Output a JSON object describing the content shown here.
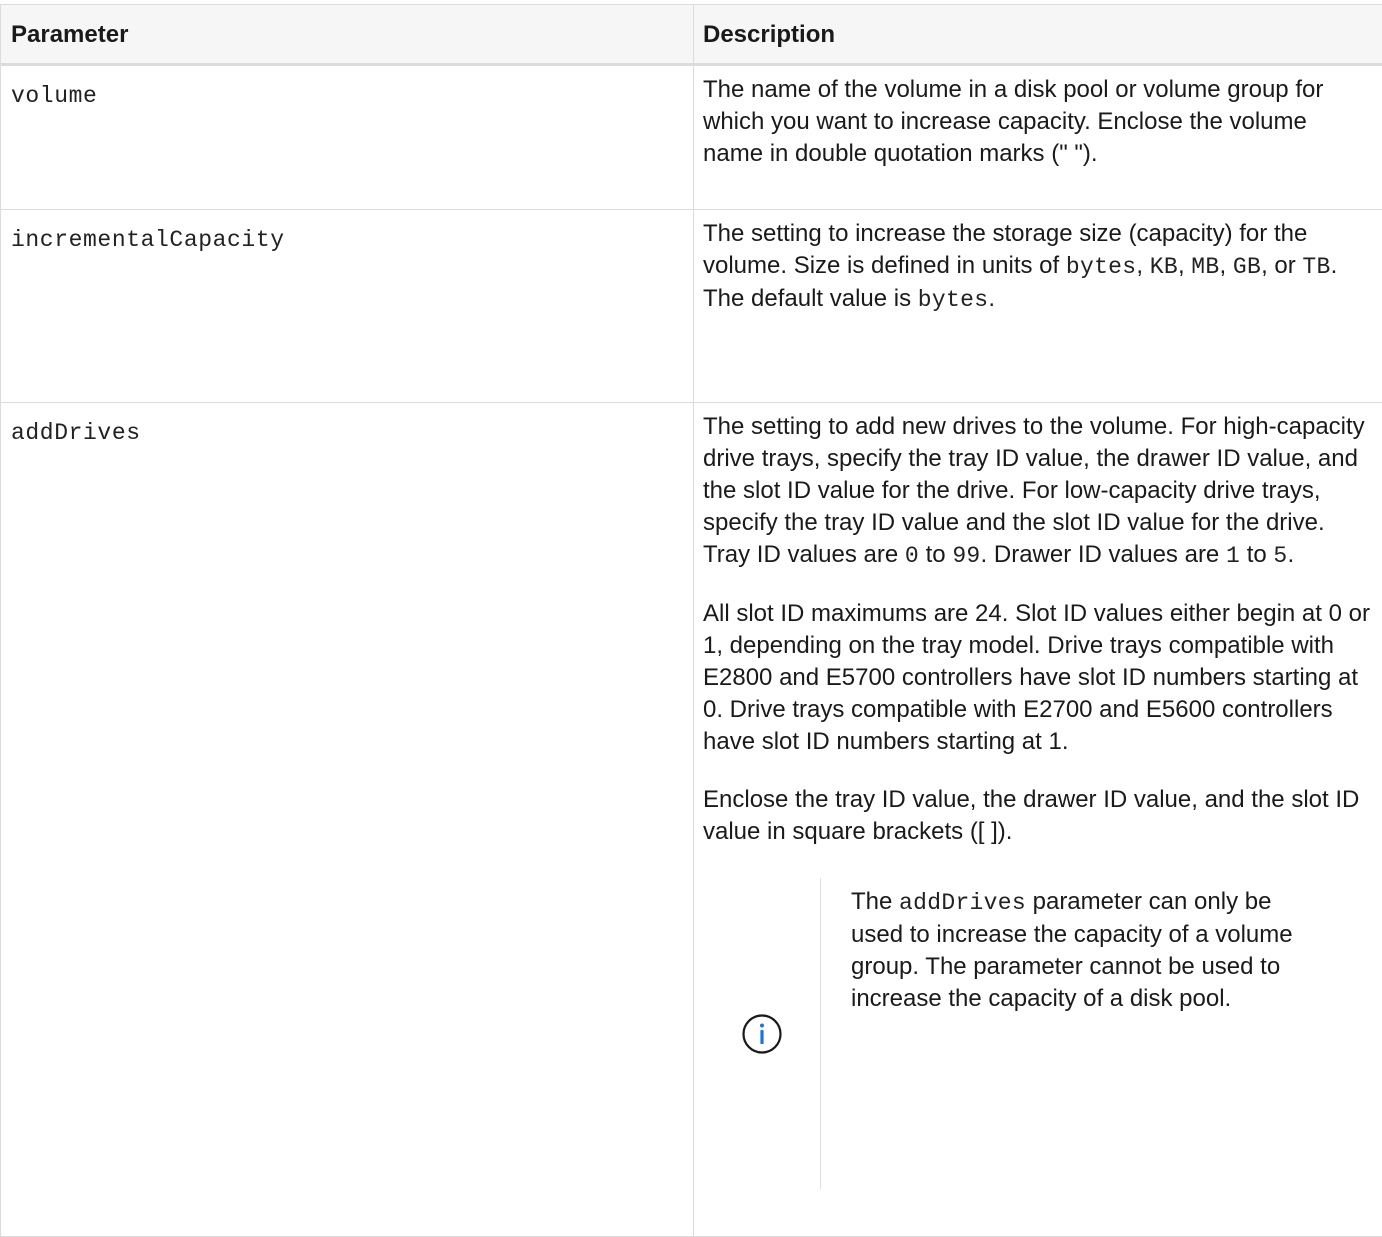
{
  "table": {
    "headers": {
      "parameter": "Parameter",
      "description": "Description"
    },
    "rows": [
      {
        "name": "volume",
        "description": "The name of the volume in a disk pool or volume group for which you want to increase capacity. Enclose the volume name in double quotation marks (\" \")."
      },
      {
        "name": "incrementalCapacity",
        "desc_1": "The setting to increase the storage size (capacity) for the volume. Size is defined in units of ",
        "desc_bytes": "bytes",
        "desc_2": ", ",
        "desc_kb": "KB",
        "desc_3": ", ",
        "desc_mb": "MB",
        "desc_4": ", ",
        "desc_gb": "GB",
        "desc_5": ", or ",
        "desc_tb": "TB",
        "desc_6": ". The default value is ",
        "desc_default": "bytes",
        "desc_7": "."
      },
      {
        "name": "addDrives",
        "para1_a": "The setting to add new drives to the volume. For high-capacity drive trays, specify the tray ID value, the drawer ID value, and the slot ID value for the drive. For low-capacity drive trays, specify the tray ID value and the slot ID value for the drive. Tray ID values are ",
        "para1_tray_min": "0",
        "para1_b": " to ",
        "para1_tray_max": "99",
        "para1_c": ". Drawer ID values are ",
        "para1_drawer_min": "1",
        "para1_d": " to ",
        "para1_drawer_max": "5",
        "para1_e": ".",
        "para2": "All slot ID maximums are 24. Slot ID values either begin at 0 or 1, depending on the tray model. Drive trays compatible with E2800 and E5700 controllers have slot ID numbers starting at 0. Drive trays compatible with E2700 and E5600 controllers have slot ID numbers starting at 1.",
        "para3": "Enclose the tray ID value, the drawer ID value, and the slot ID value in square brackets ([ ]).",
        "note": {
          "icon": "info-icon",
          "text_a": "The ",
          "text_code": "addDrives",
          "text_b": " parameter can only be used to increase the capacity of a volume group. The parameter cannot be used to increase the capacity of a disk pool."
        }
      }
    ]
  },
  "colors": {
    "border": "#dcdcdc",
    "header_bg": "#f6f6f6",
    "icon": "#1a73e8"
  }
}
